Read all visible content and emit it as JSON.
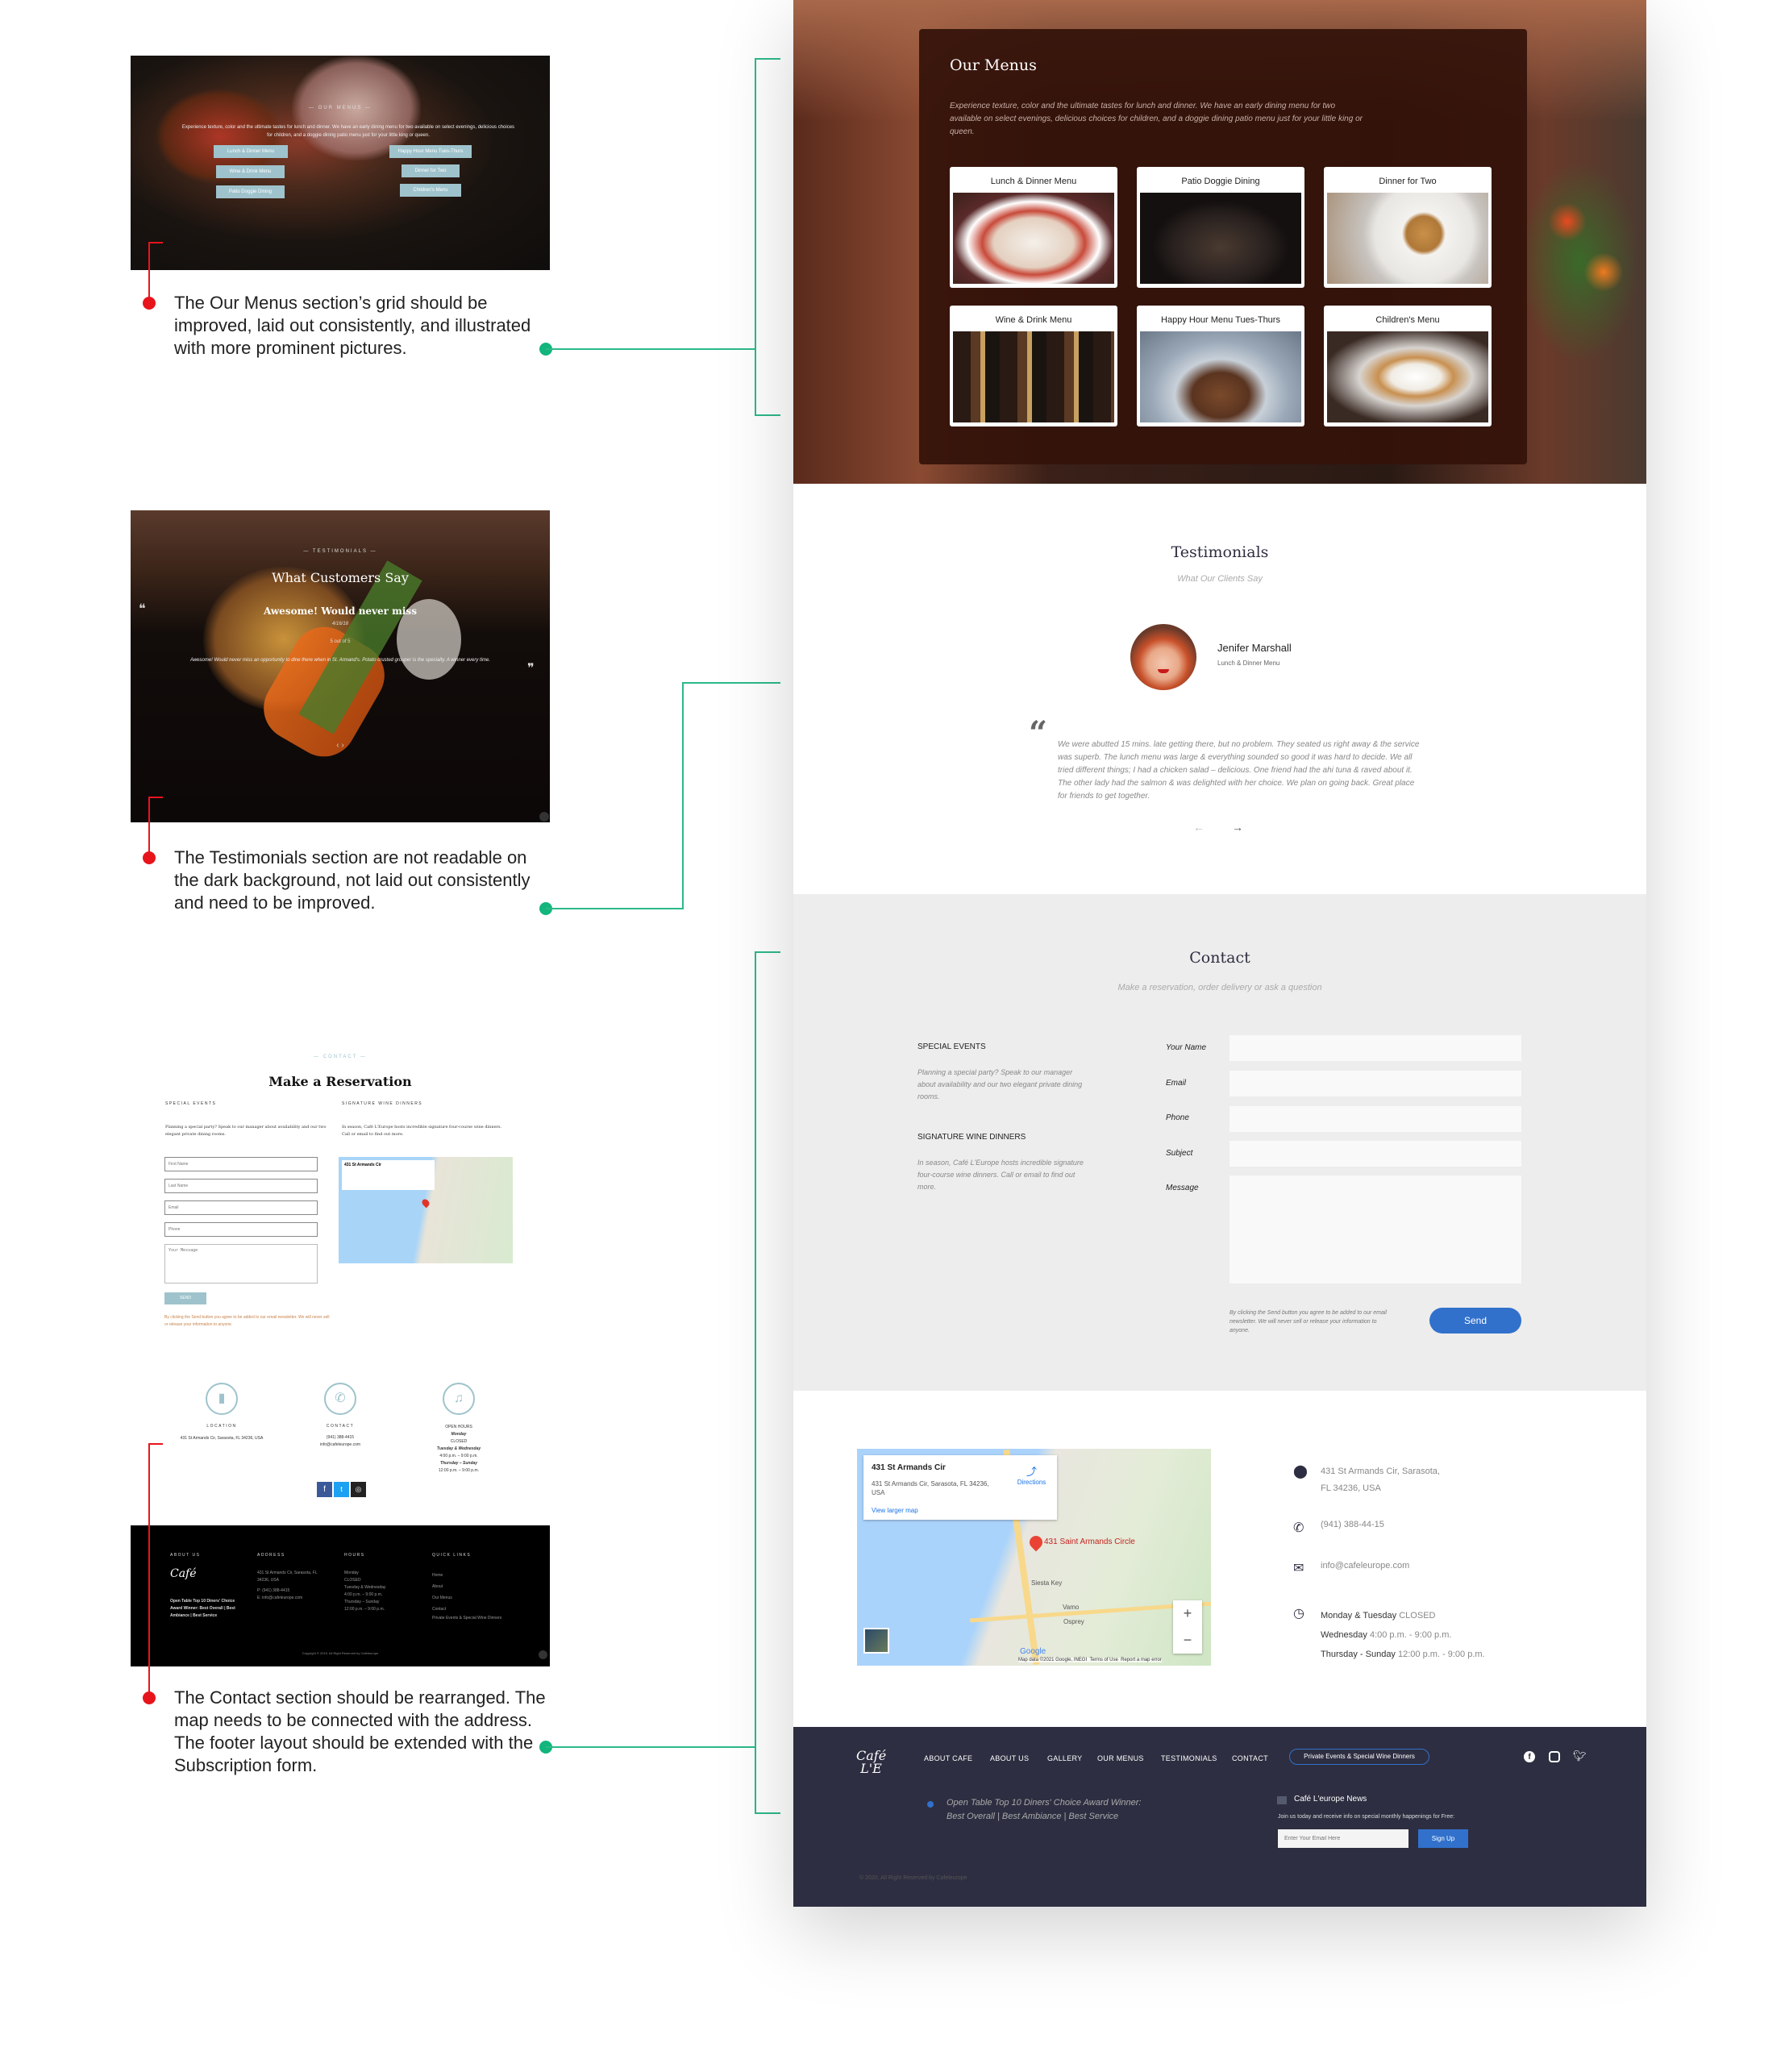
{
  "annotations": [
    {
      "text": "The Our Menus section’s grid should be improved, laid out consistently, and illustrated with more prominent pictures."
    },
    {
      "text": "The Testimonials section are not readable on the dark background, not laid out consistently and need to be improved."
    },
    {
      "text": "The Contact section should be rearranged. The map needs to be connected with the address. The footer layout should be extended with the Subscription form."
    }
  ],
  "colors": {
    "accent": "#3171cc",
    "footer_bg": "#2d2e41",
    "contact_bg": "#ededed",
    "annotation_red": "#e8141c",
    "annotation_green": "#12b57c",
    "old_button": "#9fc3cc"
  },
  "old_menus": {
    "eyebrow": "— OUR MENUS —",
    "text": "Experience texture, color and the ultimate tastes for lunch and dinner. We have an early dining menu for two available on select evenings, delicious choices for children, and a doggie dining patio menu just for your little king or queen.",
    "buttons": [
      "Lunch & Dinner Menu",
      "Wine & Drink Menu",
      "Patio Doggie Dining",
      "Happy Hour Menu Tues-Thurs",
      "Dinner for Two",
      "Children's Menu"
    ]
  },
  "old_testimonials": {
    "eyebrow": "— TESTIMONIALS —",
    "title": "What Customers Say",
    "headline": "Awesome! Would never miss",
    "date": "4/16/18",
    "rating": "5 out of 5",
    "text": "Awesome! Would never miss an opportunity to dine there when in St. Armand's. Potato crusted grouper is the specialty. A winner every time.",
    "open_quote": "❝",
    "close_quote": "❞",
    "arrows": "‹ ›"
  },
  "old_contact": {
    "eyebrow": "— CONTACT —",
    "title": "Make a Reservation",
    "special_events": "SPECIAL EVENTS",
    "special_text": "Planning a special party? Speak to our manager about availability and our two elegant private dining rooms.",
    "wine": "SIGNATURE WINE DINNERS",
    "wine_text": "In season, Café L'Europe hosts incredible signature four-course wine dinners. Call or email to find out more.",
    "placeholders": {
      "first": "First Name",
      "last": "Last Name",
      "email": "Email",
      "phone": "Phone",
      "message": "Your Message"
    },
    "send": "SEND",
    "disclaimer": "By clicking the Send button you agree to be added to our email newsletter. We will never sell or release your information to anyone.",
    "location_label": "LOCATION",
    "location": "431 St Armands Cir, Sarasota, FL 34236, USA",
    "contact_label": "CONTACT",
    "phone": "(941) 388-4415",
    "email": "info@cafeleurope.com",
    "hours_label": "OPEN HOURS",
    "hours": [
      "Monday",
      "CLOSED",
      "Tuesday & Wednesday",
      "4:00 p.m. – 9:00 p.m.",
      "Thursday – Sunday",
      "12:00 p.m. – 9:00 p.m."
    ],
    "footer": {
      "about": "ABOUT US",
      "award": "Open Table Top 10 Diners' Choice Award Winner: Best Overall | Best Ambiance | Best Service",
      "address": "ADDRESS",
      "address_lines": [
        "431 St Armands Cir, Sarasota, FL 34236, USA",
        "P: (941) 388-4415",
        "E: info@cafeleurope.com"
      ],
      "hours": "HOURS",
      "links": "QUICK LINKS",
      "link_items": [
        "Home",
        "About",
        "Our Menus",
        "Contact",
        "Private Events & Special Wine Dinners"
      ],
      "copyright": "Copyright © 2019, All Right Reserved by Cafeleurope"
    }
  },
  "menus": {
    "title": "Our Menus",
    "description": "Experience texture, color and the ultimate tastes for lunch and dinner. We have an early dining menu for two available on select evenings, delicious choices for children, and a doggie dining patio menu just for your little king or queen.",
    "cards": [
      {
        "label": "Lunch & Dinner Menu"
      },
      {
        "label": "Patio Doggie Dining"
      },
      {
        "label": "Dinner for Two"
      },
      {
        "label": "Wine & Drink Menu"
      },
      {
        "label": "Happy Hour Menu Tues-Thurs"
      },
      {
        "label": "Children's Menu"
      }
    ]
  },
  "testimonials": {
    "title": "Testimonials",
    "subtitle": "What Our Clients Say",
    "name": "Jenifer Marshall",
    "role": "Lunch & Dinner Menu",
    "quote": "We were abutted 15 mins. late getting there, but no problem. They seated us right away & the service was superb. The lunch menu was large & everything sounded so good it was hard to decide. We all tried different things; I had a chicken salad – delicious. One friend had the ahi tuna & raved about it. The other lady had the salmon & was delighted with her choice. We plan on going back. Great place for friends to get together.",
    "prev": "←",
    "next": "→"
  },
  "contact": {
    "title": "Contact",
    "subtitle": "Make a reservation, order delivery or ask a question",
    "special_events": "SPECIAL EVENTS",
    "special_text": "Planning a special party? Speak to our manager about availability and our two elegant private dining rooms.",
    "wine": "SIGNATURE WINE DINNERS",
    "wine_text": "In season, Café L'Europe hosts incredible signature four-course wine dinners. Call or email to find out more.",
    "labels": {
      "name": "Your Name",
      "email": "Email",
      "phone": "Phone",
      "subject": "Subject",
      "message": "Message"
    },
    "disclaimer": "By clicking the Send button you agree to be added to our email newsletter. We will never sell or release your information to anyone.",
    "send": "Send"
  },
  "map": {
    "place": "431 St Armands Cir",
    "address": "431 St Armands Cir, Sarasota, FL 34236, USA",
    "directions": "Directions",
    "larger": "View larger map",
    "pin_label": "431 Saint Armands Circle",
    "towns": [
      "Siesta Key",
      "Vamo",
      "Osprey"
    ],
    "google": "Google",
    "attribution": "Map data ©2021 Google, INEGI",
    "terms": "Terms of Use",
    "report": "Report a map error",
    "zoom_in": "+",
    "zoom_out": "−"
  },
  "location": {
    "address1": "431 St Armands Cir, Sarasota,",
    "address2": "FL 34236, USA",
    "phone": "(941) 388-44-15",
    "email": "info@cafeleurope.com",
    "hours": [
      {
        "day": "Monday & Tuesday",
        "time": "CLOSED"
      },
      {
        "day": "Wednesday",
        "time": "4:00 p.m. - 9:00 p.m."
      },
      {
        "day": "Thursday - Sunday",
        "time": "12:00 p.m. - 9:00 p.m."
      }
    ]
  },
  "footer": {
    "nav": [
      "ABOUT CAFE",
      "ABOUT US",
      "GALLERY",
      "OUR MENUS",
      "TESTIMONIALS",
      "CONTACT"
    ],
    "cta": "Private Events & Special Wine Dinners",
    "award1": "Open Table Top 10 Diners' Choice Award Winner:",
    "award2": "Best Overall | Best Ambiance | Best Service",
    "news_title": "Café L'europe News",
    "news_text": "Join us today and receive info on special monthly happenings for Free:",
    "email_placeholder": "Enter Your Email Here",
    "signup": "Sign Up",
    "copyright": "© 2020, All Right Reserved by Cafeleurope"
  }
}
